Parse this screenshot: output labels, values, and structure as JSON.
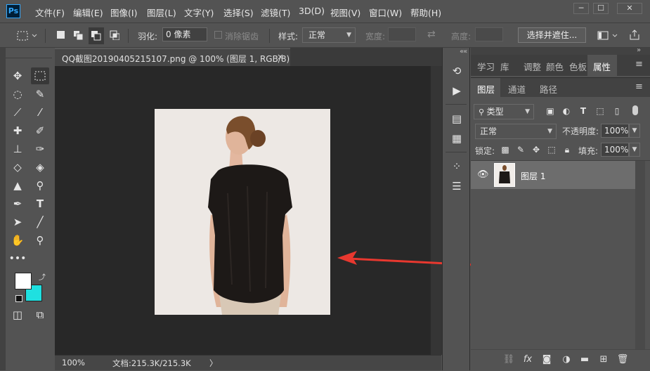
{
  "app": {
    "logo": "Ps"
  },
  "menu": [
    "文件(F)",
    "编辑(E)",
    "图像(I)",
    "图层(L)",
    "文字(Y)",
    "选择(S)",
    "滤镜(T)",
    "3D(D)",
    "视图(V)",
    "窗口(W)",
    "帮助(H)"
  ],
  "window_controls": {
    "minimize": "─",
    "maximize": "☐",
    "close": "✕"
  },
  "options": {
    "feather_label": "羽化:",
    "feather_value": "0 像素",
    "antialias_label": "消除锯齿",
    "style_label": "样式:",
    "style_value": "正常",
    "width_label": "宽度:",
    "height_label": "高度:",
    "select_mask_button": "选择并遮住..."
  },
  "document": {
    "tab_title": "QQ截图20190405215107.png @ 100% (图层 1, RGB/8)",
    "close": "×",
    "zoom": "100%",
    "doc_info": "文档:215.3K/215.3K",
    "status_arrow": "〉"
  },
  "panels": {
    "top_tabs": [
      "学习",
      "库",
      "调整",
      "颜色",
      "色板",
      "属性"
    ],
    "active_top_tab": "属性",
    "layer_tabs": [
      "图层",
      "通道",
      "路径"
    ],
    "active_layer_tab": "图层",
    "filter_kind": "类型",
    "blend_mode": "正常",
    "opacity_label": "不透明度:",
    "opacity_value": "100%",
    "lock_label": "锁定:",
    "fill_label": "填充:",
    "fill_value": "100%"
  },
  "layers": [
    {
      "name": "图层 1",
      "visible": true,
      "selected": true
    }
  ],
  "colors": {
    "foreground": "#ffffff",
    "background": "#1fe0e0",
    "arrow": "#e8382f"
  }
}
